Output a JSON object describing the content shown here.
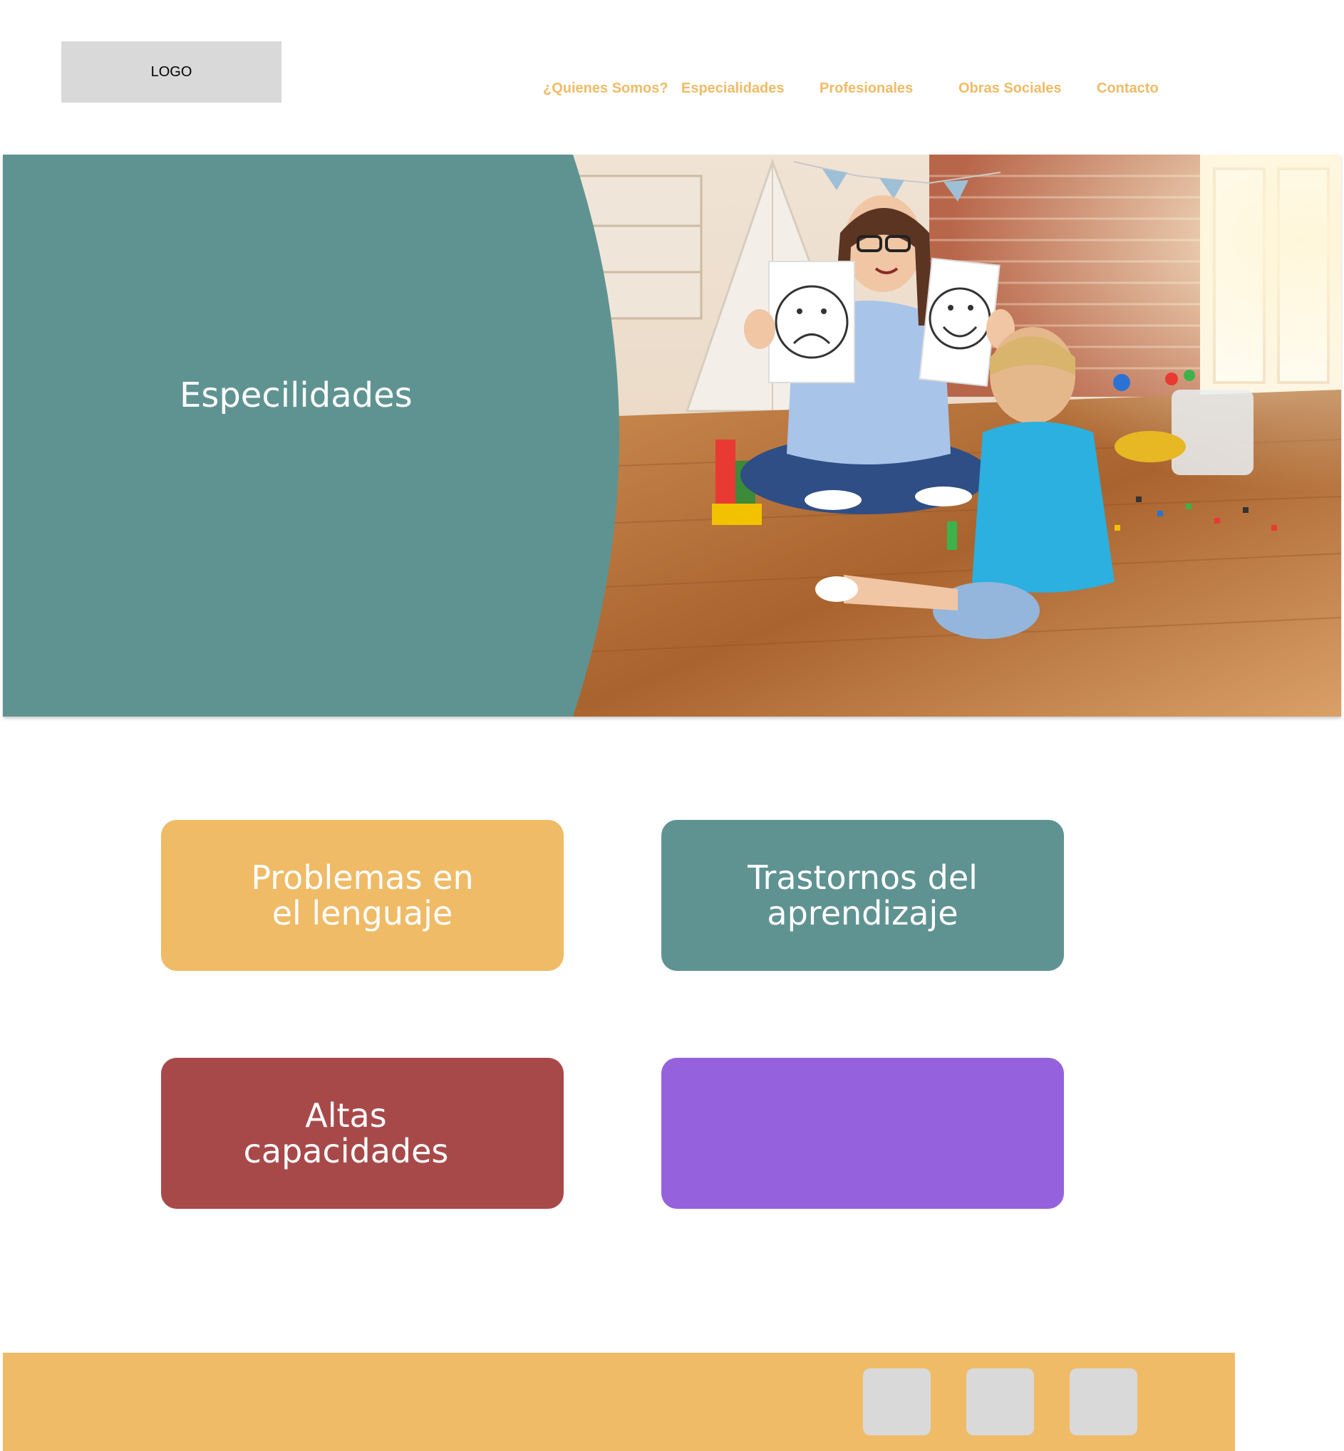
{
  "header": {
    "logo_text": "LOGO",
    "nav": [
      {
        "label": "¿Quienes Somos?"
      },
      {
        "label": "Especialidades"
      },
      {
        "label": "Profesionales"
      },
      {
        "label": "Obras Sociales"
      },
      {
        "label": "Contacto"
      }
    ]
  },
  "hero": {
    "title": "Especilidades",
    "panel_color": "#5f9392",
    "image": "photo-therapist-and-child-playing-with-emotion-faces"
  },
  "cards": [
    {
      "line1": "Problemas en",
      "line2": "el lenguaje",
      "color": "#efbb67"
    },
    {
      "line1": "Trastornos del",
      "line2": "aprendizaje",
      "color": "#5f9392"
    },
    {
      "line1": "Altas",
      "line2": "capacidades",
      "color": "#a84949"
    },
    {
      "line1": "",
      "line2": "",
      "color": "#9661dd"
    }
  ],
  "footer": {
    "color": "#efbb67",
    "social_icons": [
      "social-icon-1",
      "social-icon-2",
      "social-icon-3"
    ]
  },
  "colors": {
    "nav_text": "#efbb67",
    "placeholder_gray": "#d9d9d9"
  }
}
